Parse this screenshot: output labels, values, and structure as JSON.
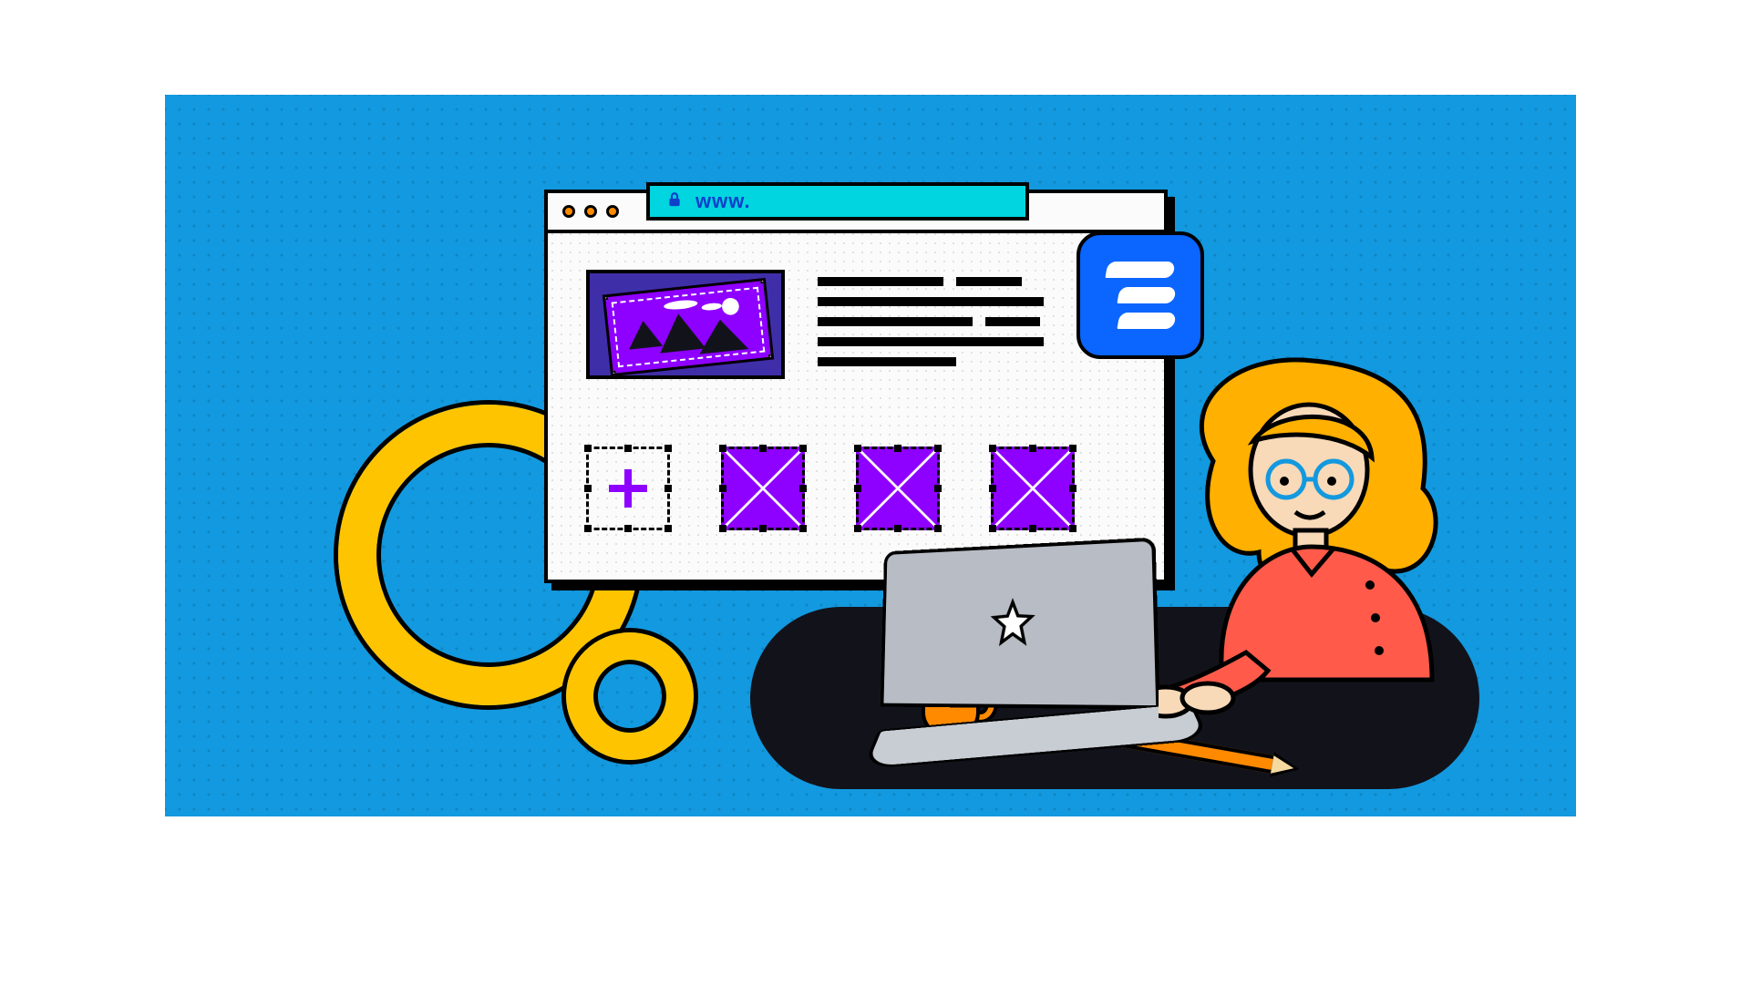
{
  "addressbar": {
    "text": "www."
  },
  "icons": {
    "lock": "lock-icon",
    "star": "star-icon",
    "plus": "plus-icon"
  },
  "colors": {
    "background": "#1399df",
    "accent_yellow": "#ffc400",
    "accent_orange": "#ff8a00",
    "accent_purple": "#8e00ff",
    "accent_indigo": "#3e2fa8",
    "badge_blue": "#0b65ff",
    "addressbar_cyan": "#00d5e0",
    "shirt_red": "#ff5a4a"
  }
}
